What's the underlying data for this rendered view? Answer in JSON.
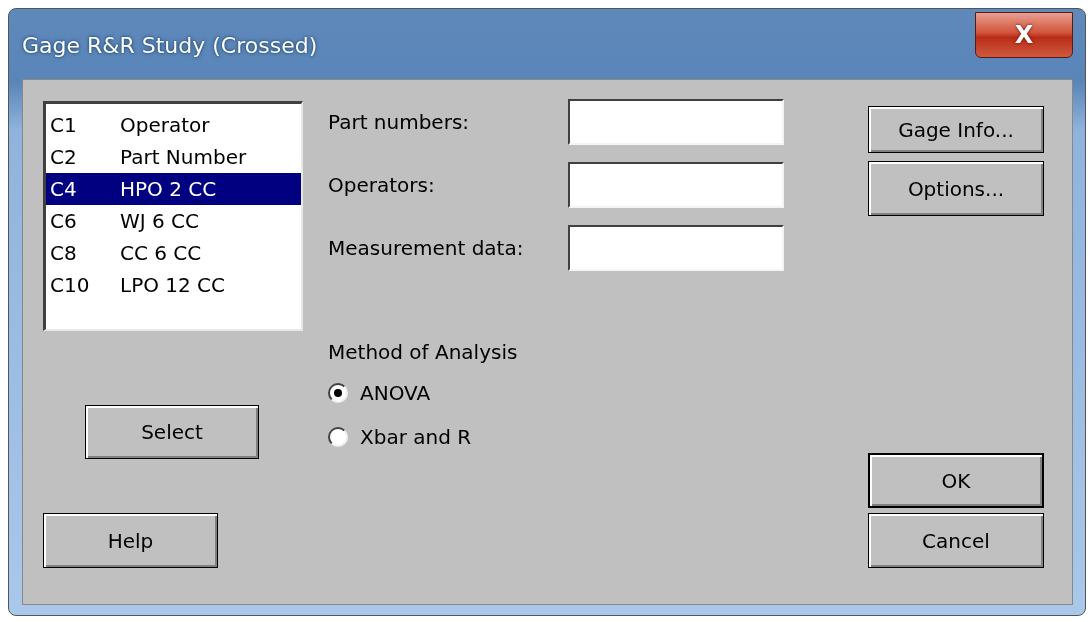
{
  "window": {
    "title": "Gage R&R Study (Crossed)",
    "close": "X"
  },
  "columns_list": [
    {
      "column": "C1",
      "name": "Operator",
      "selected": false
    },
    {
      "column": "C2",
      "name": "Part Number",
      "selected": false
    },
    {
      "column": "C4",
      "name": "HPO 2 CC",
      "selected": true
    },
    {
      "column": "C6",
      "name": "WJ 6 CC",
      "selected": false
    },
    {
      "column": "C8",
      "name": "CC 6 CC",
      "selected": false
    },
    {
      "column": "C10",
      "name": "LPO 12 CC",
      "selected": false
    }
  ],
  "select_button": "Select",
  "help_button": "Help",
  "fields": [
    {
      "label": "Part numbers:"
    },
    {
      "label": "Operators:"
    },
    {
      "label": "Measurement data:"
    }
  ],
  "method": {
    "label": "Method of Analysis",
    "options": [
      {
        "label": "ANOVA",
        "selected": true
      },
      {
        "label": "Xbar and R",
        "selected": false
      }
    ]
  },
  "side_buttons": [
    "Gage Info...",
    "Options..."
  ],
  "dialog_buttons": [
    {
      "label": "OK",
      "default": true
    },
    {
      "label": "Cancel",
      "default": false
    }
  ]
}
